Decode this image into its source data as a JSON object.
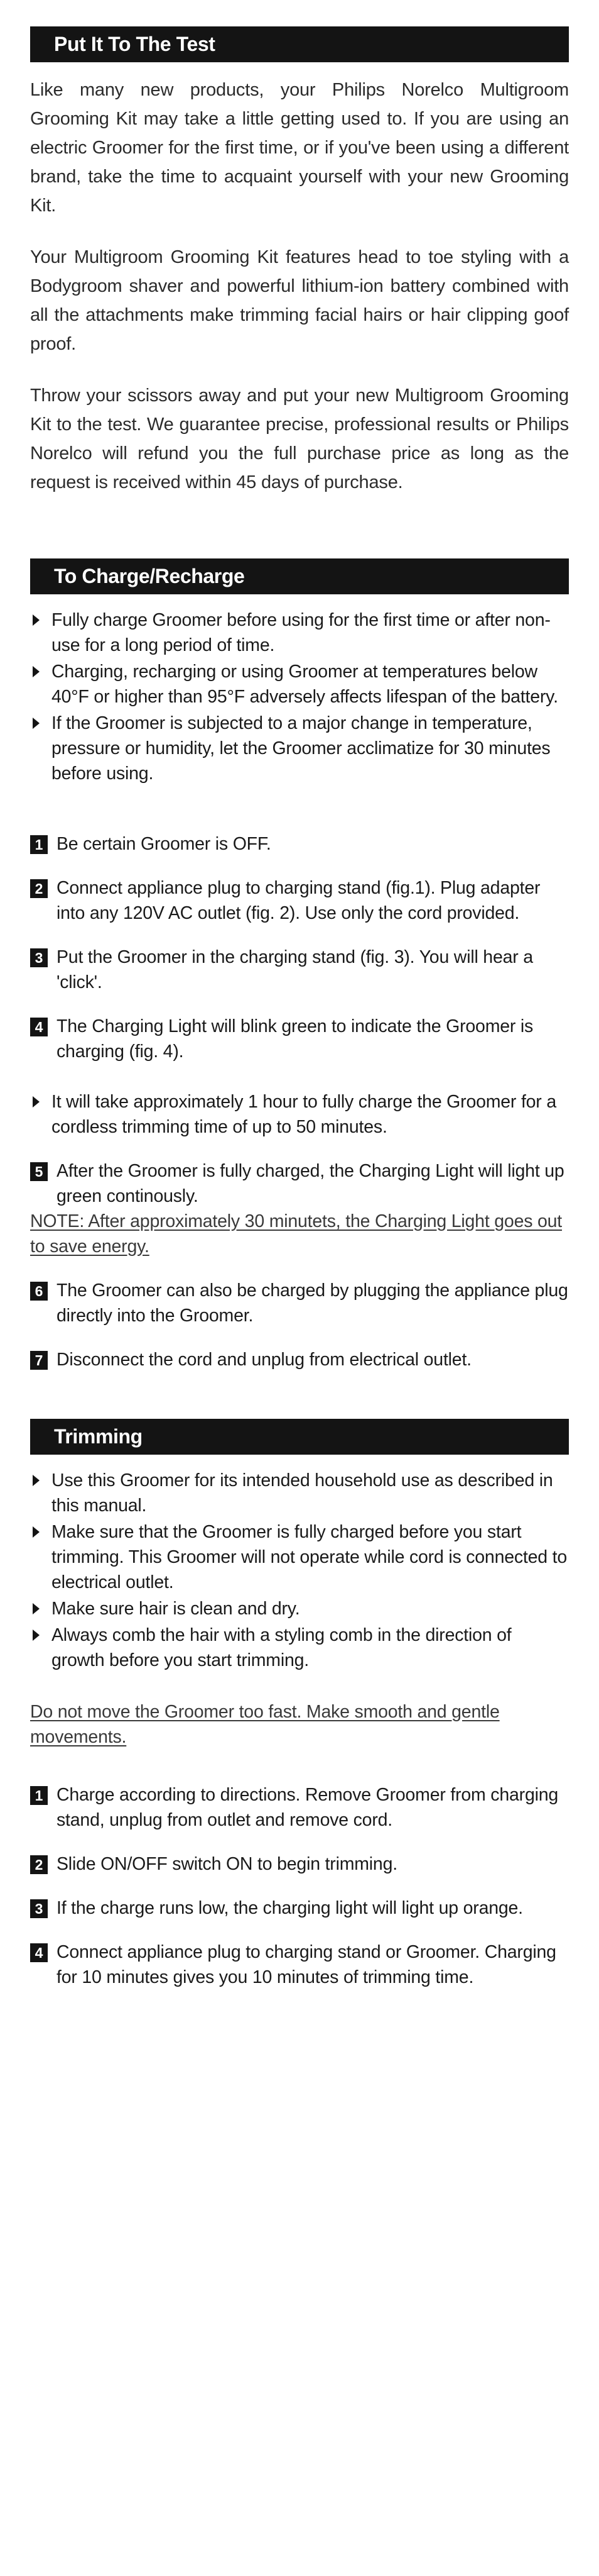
{
  "document": {
    "brand": "Philips Norelco",
    "product": "Multigroom Grooming Kit"
  },
  "sections": [
    {
      "id": "put-it-to-the-test",
      "title": "Put It To The Test",
      "paragraphs": [
        "Like many new products, your Philips Norelco Multigroom Grooming Kit may take a little getting used to. If you are using an electric Groomer for the first time, or if you've been using a different brand, take the time to acquaint yourself with your new Grooming Kit.",
        "Your Multigroom Grooming Kit features head to toe styling with a Bodygroom shaver and powerful lithium-ion battery combined with all the attachments make trimming facial hairs or hair clipping goof proof.",
        "Throw your scissors away and put your new Multigroom Grooming Kit to the test. We guarantee precise, professional results or Philips Norelco will refund you the full purchase price as long as the request is received within 45 days of purchase."
      ]
    },
    {
      "id": "to-charge-recharge",
      "title": "To Charge/Recharge",
      "bullets": [
        "Fully charge Groomer before using for the first time or after non-use for a long period of time.",
        "Charging, recharging or using Groomer at temperatures below 40°F or higher than 95°F adversely affects lifespan of the battery.",
        "If the Groomer is subjected to a major change in temperature, pressure or humidity, let the Groomer acclimatize for 30 minutes before using."
      ],
      "steps_1": [
        {
          "number": "1",
          "text": "Be certain Groomer is OFF."
        },
        {
          "number": "2",
          "text": "Connect appliance plug to charging stand (fig.1). Plug adapter into any 120V AC outlet (fig. 2). Use only the cord provided."
        },
        {
          "number": "3",
          "text": "Put the Groomer in the charging stand (fig. 3). You will hear a 'click'."
        },
        {
          "number": "4",
          "text": "The Charging Light will blink green to indicate the Groomer is charging (fig. 4)."
        }
      ],
      "mid_bullets": [
        "It will take approximately 1 hour to fully charge the Groomer for a cordless trimming time of up to 50 minutes."
      ],
      "step_5": {
        "number": "5",
        "text": "After the Groomer is fully charged, the Charging Light will light up green continously."
      },
      "note": "NOTE: After approximately 30 minutets, the Charging Light goes out to save energy.",
      "steps_2": [
        {
          "number": "6",
          "text": "The Groomer can also be charged by plugging the appliance plug directly into the Groomer."
        },
        {
          "number": "7",
          "text": "Disconnect the cord and unplug from electrical outlet."
        }
      ]
    },
    {
      "id": "trimming",
      "title": "Trimming",
      "bullets": [
        "Use this Groomer for its intended household use as described in this manual.",
        "Make sure that the Groomer is fully charged before you start trimming. This Groomer will not operate while cord is connected to electrical outlet.",
        "Make sure hair is clean and dry.",
        "Always comb the hair with a styling comb in the direction of growth before you start trimming."
      ],
      "note": "Do not move the Groomer too fast. Make smooth and gentle movements.",
      "steps": [
        {
          "number": "1",
          "text": "Charge according to directions. Remove Groomer from charging stand, unplug from outlet and remove cord."
        },
        {
          "number": "2",
          "text": "Slide ON/OFF switch ON to begin trimming."
        },
        {
          "number": "3",
          "text": "If the charge runs low, the charging light will light up orange."
        },
        {
          "number": "4",
          "text": "Connect appliance plug to charging stand or Groomer. Charging for 10 minutes gives you 10 minutes of trimming time."
        }
      ]
    }
  ],
  "colors": {
    "header_bar": "#141414",
    "header_text": "#ffffff",
    "body_text": "#1a1a1a",
    "page_background": "#ffffff"
  }
}
